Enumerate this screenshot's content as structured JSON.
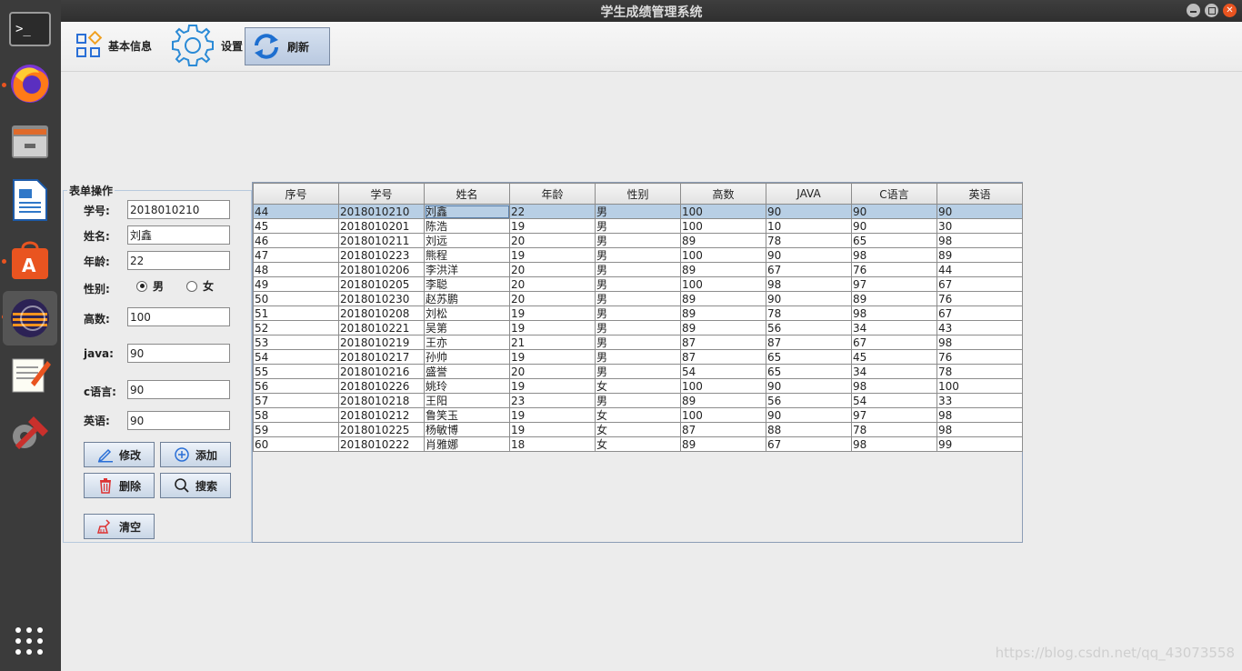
{
  "window": {
    "title": "学生成绩管理系统"
  },
  "toolbar": {
    "basic_info_label": "基本信息",
    "settings_label": "设置",
    "refresh_label": "刷新"
  },
  "form": {
    "legend": "表单操作",
    "student_id_label": "学号:",
    "student_id_value": "2018010210",
    "name_label": "姓名:",
    "name_value": "刘鑫",
    "age_label": "年龄:",
    "age_value": "22",
    "gender_label": "性别:",
    "gender_male": "男",
    "gender_female": "女",
    "gender_selected": "男",
    "math_label": "高数:",
    "math_value": "100",
    "java_label": "java:",
    "java_value": "90",
    "c_label": "c语言:",
    "c_value": "90",
    "english_label": "英语:",
    "english_value": "90"
  },
  "buttons": {
    "edit": "修改",
    "add": "添加",
    "delete": "删除",
    "search": "搜索",
    "clear": "清空"
  },
  "table": {
    "columns": [
      "序号",
      "学号",
      "姓名",
      "年龄",
      "性别",
      "高数",
      "JAVA",
      "C语言",
      "英语"
    ],
    "selected_row": 0,
    "rows": [
      [
        "44",
        "2018010210",
        "刘鑫",
        "22",
        "男",
        "100",
        "90",
        "90",
        "90"
      ],
      [
        "45",
        "2018010201",
        "陈浩",
        "19",
        "男",
        "100",
        "10",
        "90",
        "30"
      ],
      [
        "46",
        "2018010211",
        "刘远",
        "20",
        "男",
        "89",
        "78",
        "65",
        "98"
      ],
      [
        "47",
        "2018010223",
        "熊程",
        "19",
        "男",
        "100",
        "90",
        "98",
        "89"
      ],
      [
        "48",
        "2018010206",
        "李洪洋",
        "20",
        "男",
        "89",
        "67",
        "76",
        "44"
      ],
      [
        "49",
        "2018010205",
        "李聪",
        "20",
        "男",
        "100",
        "98",
        "97",
        "67"
      ],
      [
        "50",
        "2018010230",
        "赵苏鹏",
        "20",
        "男",
        "89",
        "90",
        "89",
        "76"
      ],
      [
        "51",
        "2018010208",
        "刘松",
        "19",
        "男",
        "89",
        "78",
        "98",
        "67"
      ],
      [
        "52",
        "2018010221",
        "吴第",
        "19",
        "男",
        "89",
        "56",
        "34",
        "43"
      ],
      [
        "53",
        "2018010219",
        "王亦",
        "21",
        "男",
        "87",
        "87",
        "67",
        "98"
      ],
      [
        "54",
        "2018010217",
        "孙帅",
        "19",
        "男",
        "87",
        "65",
        "45",
        "76"
      ],
      [
        "55",
        "2018010216",
        "盛誉",
        "20",
        "男",
        "54",
        "65",
        "34",
        "78"
      ],
      [
        "56",
        "2018010226",
        "姚玲",
        "19",
        "女",
        "100",
        "90",
        "98",
        "100"
      ],
      [
        "57",
        "2018010218",
        "王阳",
        "23",
        "男",
        "89",
        "56",
        "54",
        "33"
      ],
      [
        "58",
        "2018010212",
        "鲁笑玉",
        "19",
        "女",
        "100",
        "90",
        "97",
        "98"
      ],
      [
        "59",
        "2018010225",
        "杨敏博",
        "19",
        "女",
        "87",
        "88",
        "78",
        "98"
      ],
      [
        "60",
        "2018010222",
        "肖雅娜",
        "18",
        "女",
        "89",
        "67",
        "98",
        "99"
      ]
    ]
  },
  "watermark": "https://blog.csdn.net/qq_43073558",
  "dock": {
    "items": [
      "terminal-icon",
      "firefox-icon",
      "files-icon",
      "writer-icon",
      "software-center-icon",
      "eclipse-icon",
      "text-editor-icon",
      "settings-tools-icon"
    ]
  }
}
